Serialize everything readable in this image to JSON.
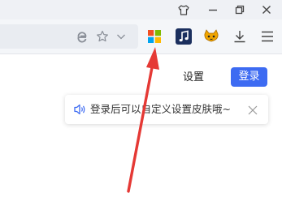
{
  "titlebar": {
    "icons": [
      "skin-icon",
      "minimize-icon",
      "restore-icon",
      "close-icon"
    ]
  },
  "toolbar": {
    "icons": [
      "ie-mode-icon",
      "favorite-star-icon",
      "address-dropdown-icon",
      "app-grid-icon",
      "music-icon",
      "game-icon",
      "download-icon",
      "menu-icon"
    ]
  },
  "content": {
    "settings_label": "设置",
    "login_label": "登录",
    "login_color": "#3d6bf2",
    "tip_text": "登录后可以自定义设置皮肤哦~",
    "annotation_color": "#e53935"
  }
}
